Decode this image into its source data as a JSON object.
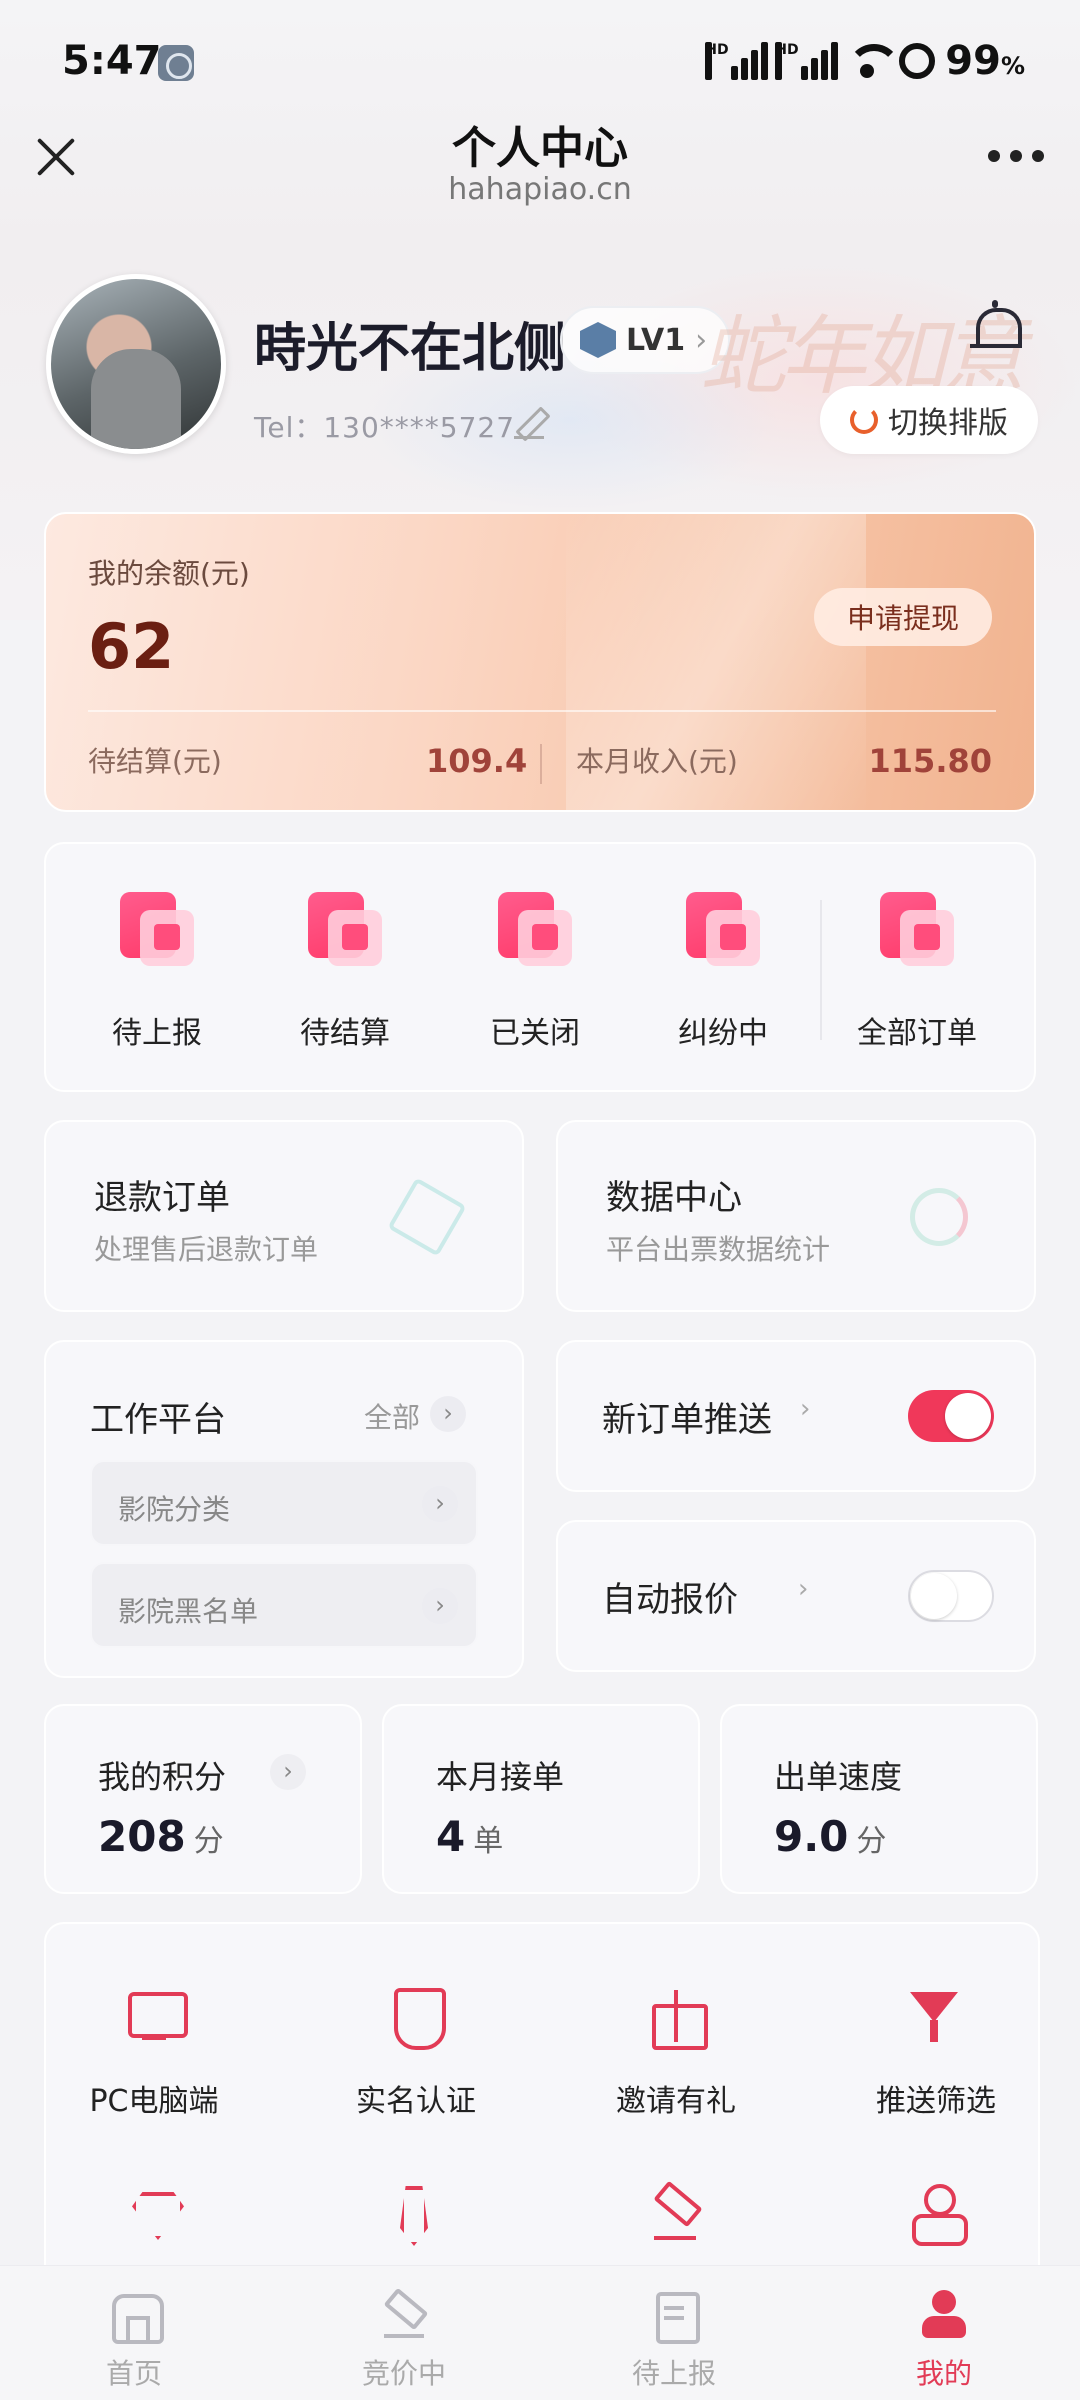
{
  "status_bar": {
    "time": "5:47",
    "battery": "99",
    "battery_unit": "%",
    "network_label": "HD"
  },
  "nav": {
    "title": "个人中心",
    "subtitle": "hahapiao.cn"
  },
  "profile": {
    "name": "時光不在北侧",
    "level": "LV1",
    "tel": "Tel：130****5727",
    "decoration_text": "蛇年如意",
    "switch_layout_label": "切换排版"
  },
  "balance": {
    "label": "我的余额(元)",
    "value": "62",
    "withdraw_label": "申请提现",
    "pending_label": "待结算(元)",
    "pending_value": "109.4",
    "month_label": "本月收入(元)",
    "month_value": "115.80"
  },
  "orders": [
    {
      "label": "待上报",
      "icon": "report-icon"
    },
    {
      "label": "待结算",
      "icon": "settle-icon"
    },
    {
      "label": "已关闭",
      "icon": "closed-icon"
    },
    {
      "label": "纠纷中",
      "icon": "dispute-icon"
    },
    {
      "label": "全部订单",
      "icon": "all-orders-icon"
    }
  ],
  "refund": {
    "title": "退款订单",
    "subtitle": "处理售后退款订单"
  },
  "data_center": {
    "title": "数据中心",
    "subtitle": "平台出票数据统计"
  },
  "work_platform": {
    "title": "工作平台",
    "all_label": "全部",
    "items": [
      "影院分类",
      "影院黑名单"
    ]
  },
  "push_toggle": {
    "label": "新订单推送",
    "on": true
  },
  "auto_quote": {
    "label": "自动报价",
    "on": false
  },
  "stats": [
    {
      "title": "我的积分",
      "value": "208",
      "unit": "分"
    },
    {
      "title": "本月接单",
      "value": "4",
      "unit": "单"
    },
    {
      "title": "出单速度",
      "value": "9.0",
      "unit": "分"
    }
  ],
  "tools": [
    {
      "label": "PC电脑端",
      "icon": "monitor-icon"
    },
    {
      "label": "实名认证",
      "icon": "shield-icon"
    },
    {
      "label": "邀请有礼",
      "icon": "gift-icon"
    },
    {
      "label": "推送筛选",
      "icon": "filter-icon"
    }
  ],
  "tabs": [
    {
      "label": "首页",
      "icon": "home-icon"
    },
    {
      "label": "竞价中",
      "icon": "auction-hammer-icon"
    },
    {
      "label": "待上报",
      "icon": "document-icon"
    },
    {
      "label": "我的",
      "icon": "user-icon"
    }
  ],
  "colors": {
    "accent": "#e23b56",
    "toggle_on": "#f0385a",
    "balance_value": "#6b1f12"
  }
}
